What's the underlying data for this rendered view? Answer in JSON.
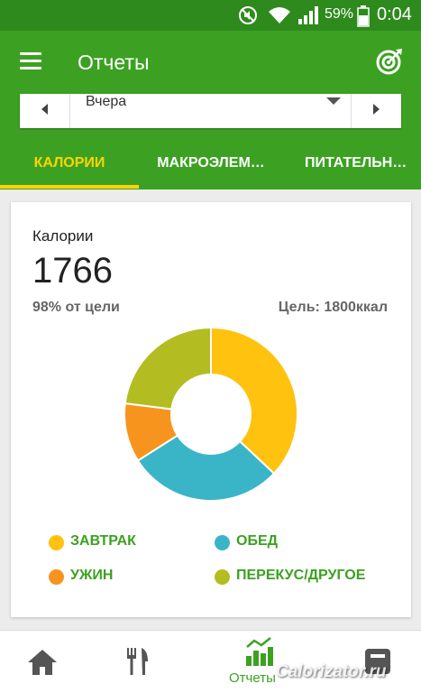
{
  "status_bar": {
    "battery": "59%",
    "time": "0:04",
    "icons": [
      "mute-icon",
      "wifi-icon",
      "signal-icon",
      "battery-icon"
    ]
  },
  "app_bar": {
    "title": "Отчеты",
    "menu_icon": "menu-icon",
    "action_icon": "target-icon"
  },
  "date_selector": {
    "value": "Вчера"
  },
  "tabs": [
    {
      "label": "КАЛОРИИ",
      "active": true
    },
    {
      "label": "МАКРОЭЛЕМ…",
      "active": false
    },
    {
      "label": "ПИТАТЕЛЬН…",
      "active": false
    }
  ],
  "calories_card": {
    "title": "Калории",
    "value": "1766",
    "percent_text": "98% от цели",
    "goal_text": "Цель: 1800ккал"
  },
  "chart_data": {
    "type": "pie",
    "categories": [
      "ЗАВТРАК",
      "ОБЕД",
      "УЖИН",
      "ПЕРЕКУС/ДРУГОЕ"
    ],
    "values": [
      37,
      29,
      11,
      23
    ],
    "colors": [
      "#ffc20e",
      "#3ab5c8",
      "#f7941d",
      "#b3bd22"
    ]
  },
  "legend": [
    {
      "label": "ЗАВТРАК",
      "color": "#ffc20e"
    },
    {
      "label": "ОБЕД",
      "color": "#3ab5c8"
    },
    {
      "label": "УЖИН",
      "color": "#f7941d"
    },
    {
      "label": "ПЕРЕКУС/ДРУГОЕ",
      "color": "#b3bd22"
    }
  ],
  "bottom_nav": {
    "items": [
      {
        "icon": "home-icon",
        "label": ""
      },
      {
        "icon": "food-icon",
        "label": ""
      },
      {
        "icon": "reports-icon",
        "label": "Отчеты"
      },
      {
        "icon": "diary-icon",
        "label": ""
      }
    ]
  },
  "watermark": "Calorizator.ru",
  "colors": {
    "primary": "#3ca122",
    "status_bar": "#2e8a1c",
    "accent": "#ffd400"
  }
}
